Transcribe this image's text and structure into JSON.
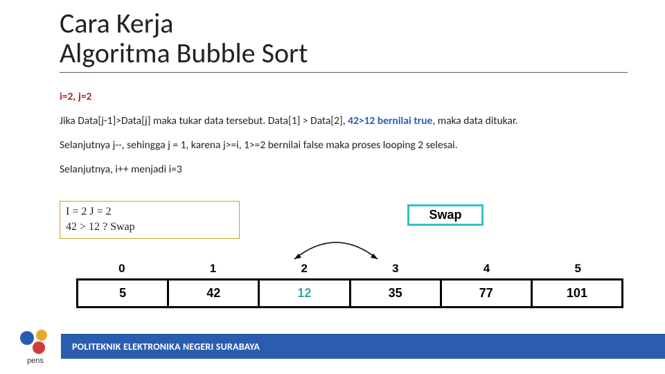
{
  "title_line1": "Cara Kerja",
  "title_line2": "Algoritma Bubble Sort",
  "step_heading": "i=2, j=2",
  "para1_a": "Jika Data[j-1]>Data[j] maka tukar data tersebut. Data[1] > Data[2], ",
  "para1_b": "42>12 bernilai true",
  "para1_c": ", maka data ditukar.",
  "para2": "Selanjutnya j--, sehingga j = 1, karena j>=i, 1>=2 bernilai false maka proses looping 2 selesai.",
  "para3": "Selanjutnya, i++ menjadi i=3",
  "state_line1": "I = 2 J = 2",
  "state_line2": "42 > 12 ? Swap",
  "swap_label": "Swap",
  "indices": [
    "0",
    "1",
    "2",
    "3",
    "4",
    "5"
  ],
  "cells": [
    {
      "v": "5",
      "teal": false
    },
    {
      "v": "42",
      "teal": false
    },
    {
      "v": "12",
      "teal": true
    },
    {
      "v": "35",
      "teal": false
    },
    {
      "v": "77",
      "teal": false
    },
    {
      "v": "101",
      "teal": false
    }
  ],
  "footer": "POLITEKNIK ELEKTRONIKA NEGERI SURABAYA",
  "logo_text": "pens"
}
